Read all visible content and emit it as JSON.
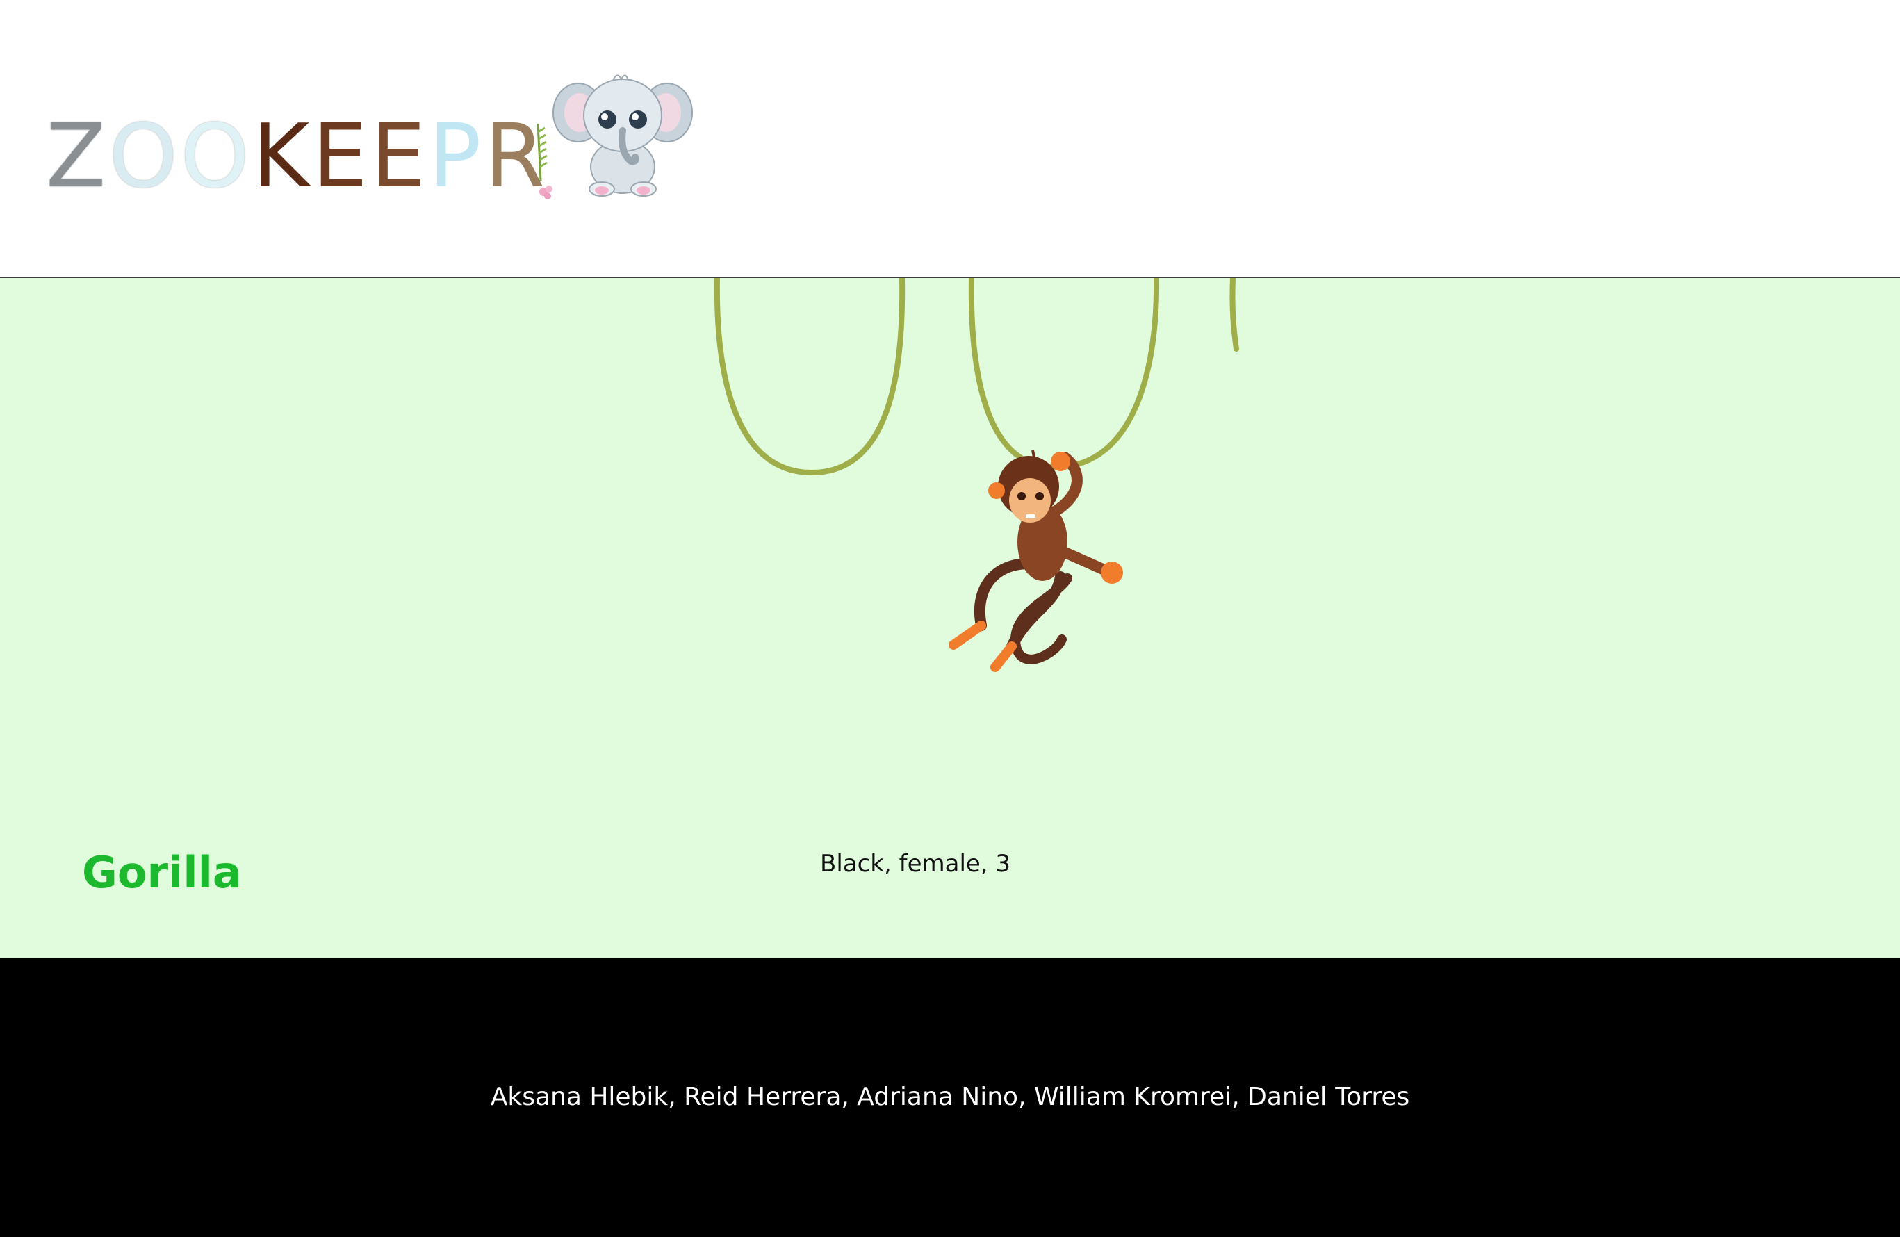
{
  "header": {
    "logo_text": "ZOOKEEPR",
    "logo_letter_colors": [
      "#8a8f93",
      "#d8ecf2",
      "#dff3f7",
      "#5a2a14",
      "#6b3a20",
      "#7a4a2e",
      "#bfe6f2",
      "#9a7e5e"
    ],
    "mascot": "elephant-icon"
  },
  "main": {
    "background": "#e0fcdd",
    "illustration": "monkey-on-vines",
    "animal_name": "Gorilla",
    "animal_info": "Black, female, 3"
  },
  "footer": {
    "credits": "Aksana Hlebik, Reid Herrera, Adriana Nino, William Kromrei, Daniel Torres"
  },
  "colors": {
    "title_green": "#1cb92e",
    "vine_green": "#9fae48",
    "footer_bg": "#000000"
  }
}
